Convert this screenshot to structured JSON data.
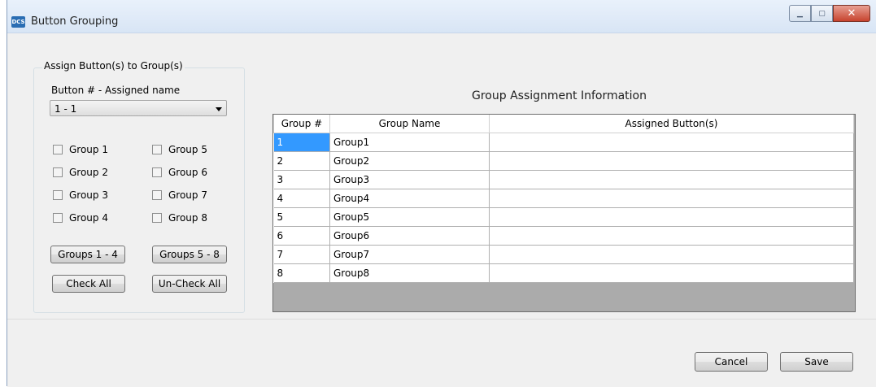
{
  "window": {
    "title": "Button Grouping",
    "app_icon_text": "DCS"
  },
  "assign_group": {
    "legend": "Assign Button(s) to Group(s)",
    "button_label": "Button # - Assigned name",
    "button_select_value": "1 - 1",
    "checkboxes": [
      "Group 1",
      "Group 2",
      "Group 3",
      "Group 4",
      "Group 5",
      "Group 6",
      "Group 7",
      "Group 8"
    ],
    "groups_1_4_label": "Groups 1 - 4",
    "groups_5_8_label": "Groups 5 - 8",
    "check_all_label": "Check All",
    "uncheck_all_label": "Un-Check All"
  },
  "table": {
    "title": "Group Assignment Information",
    "columns": [
      "Group #",
      "Group Name",
      "Assigned Button(s)"
    ],
    "rows": [
      {
        "num": "1",
        "name": "Group1",
        "buttons": ""
      },
      {
        "num": "2",
        "name": "Group2",
        "buttons": ""
      },
      {
        "num": "3",
        "name": "Group3",
        "buttons": ""
      },
      {
        "num": "4",
        "name": "Group4",
        "buttons": ""
      },
      {
        "num": "5",
        "name": "Group5",
        "buttons": ""
      },
      {
        "num": "6",
        "name": "Group6",
        "buttons": ""
      },
      {
        "num": "7",
        "name": "Group7",
        "buttons": ""
      },
      {
        "num": "8",
        "name": "Group8",
        "buttons": ""
      }
    ]
  },
  "footer": {
    "cancel_label": "Cancel",
    "save_label": "Save"
  },
  "colors": {
    "selection": "#3399ff",
    "close_button": "#c7432e"
  }
}
